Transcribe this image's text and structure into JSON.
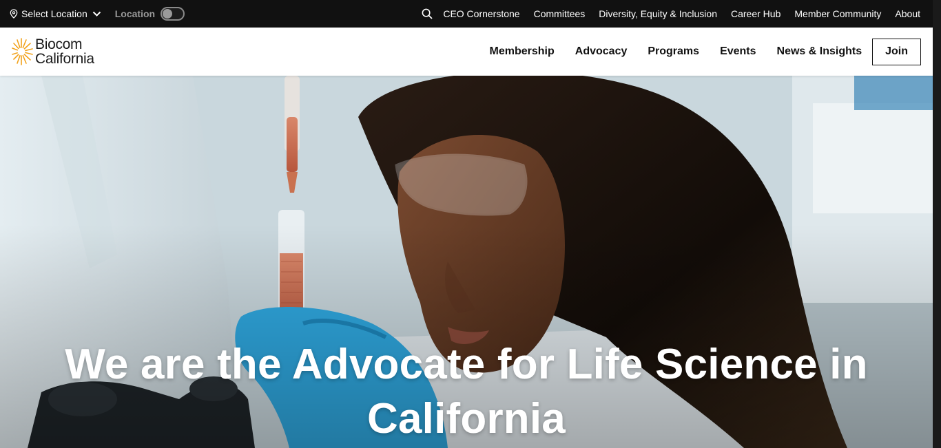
{
  "utility_bar": {
    "location_select_label": "Select Location",
    "location_toggle_label": "Location",
    "location_toggle_on": false,
    "links": [
      "CEO Cornerstone",
      "Committees",
      "Diversity, Equity & Inclusion",
      "Career Hub",
      "Member Community",
      "About"
    ]
  },
  "header": {
    "logo_line1": "Biocom",
    "logo_line2": "California",
    "nav": [
      "Membership",
      "Advocacy",
      "Programs",
      "Events",
      "News & Insights"
    ],
    "join_label": "Join"
  },
  "hero": {
    "title": "We are the Advocate for Life Science in California"
  },
  "colors": {
    "utility_bg": "#111111",
    "logo_accent": "#F2A21A",
    "glove": "#2FA8E0"
  }
}
